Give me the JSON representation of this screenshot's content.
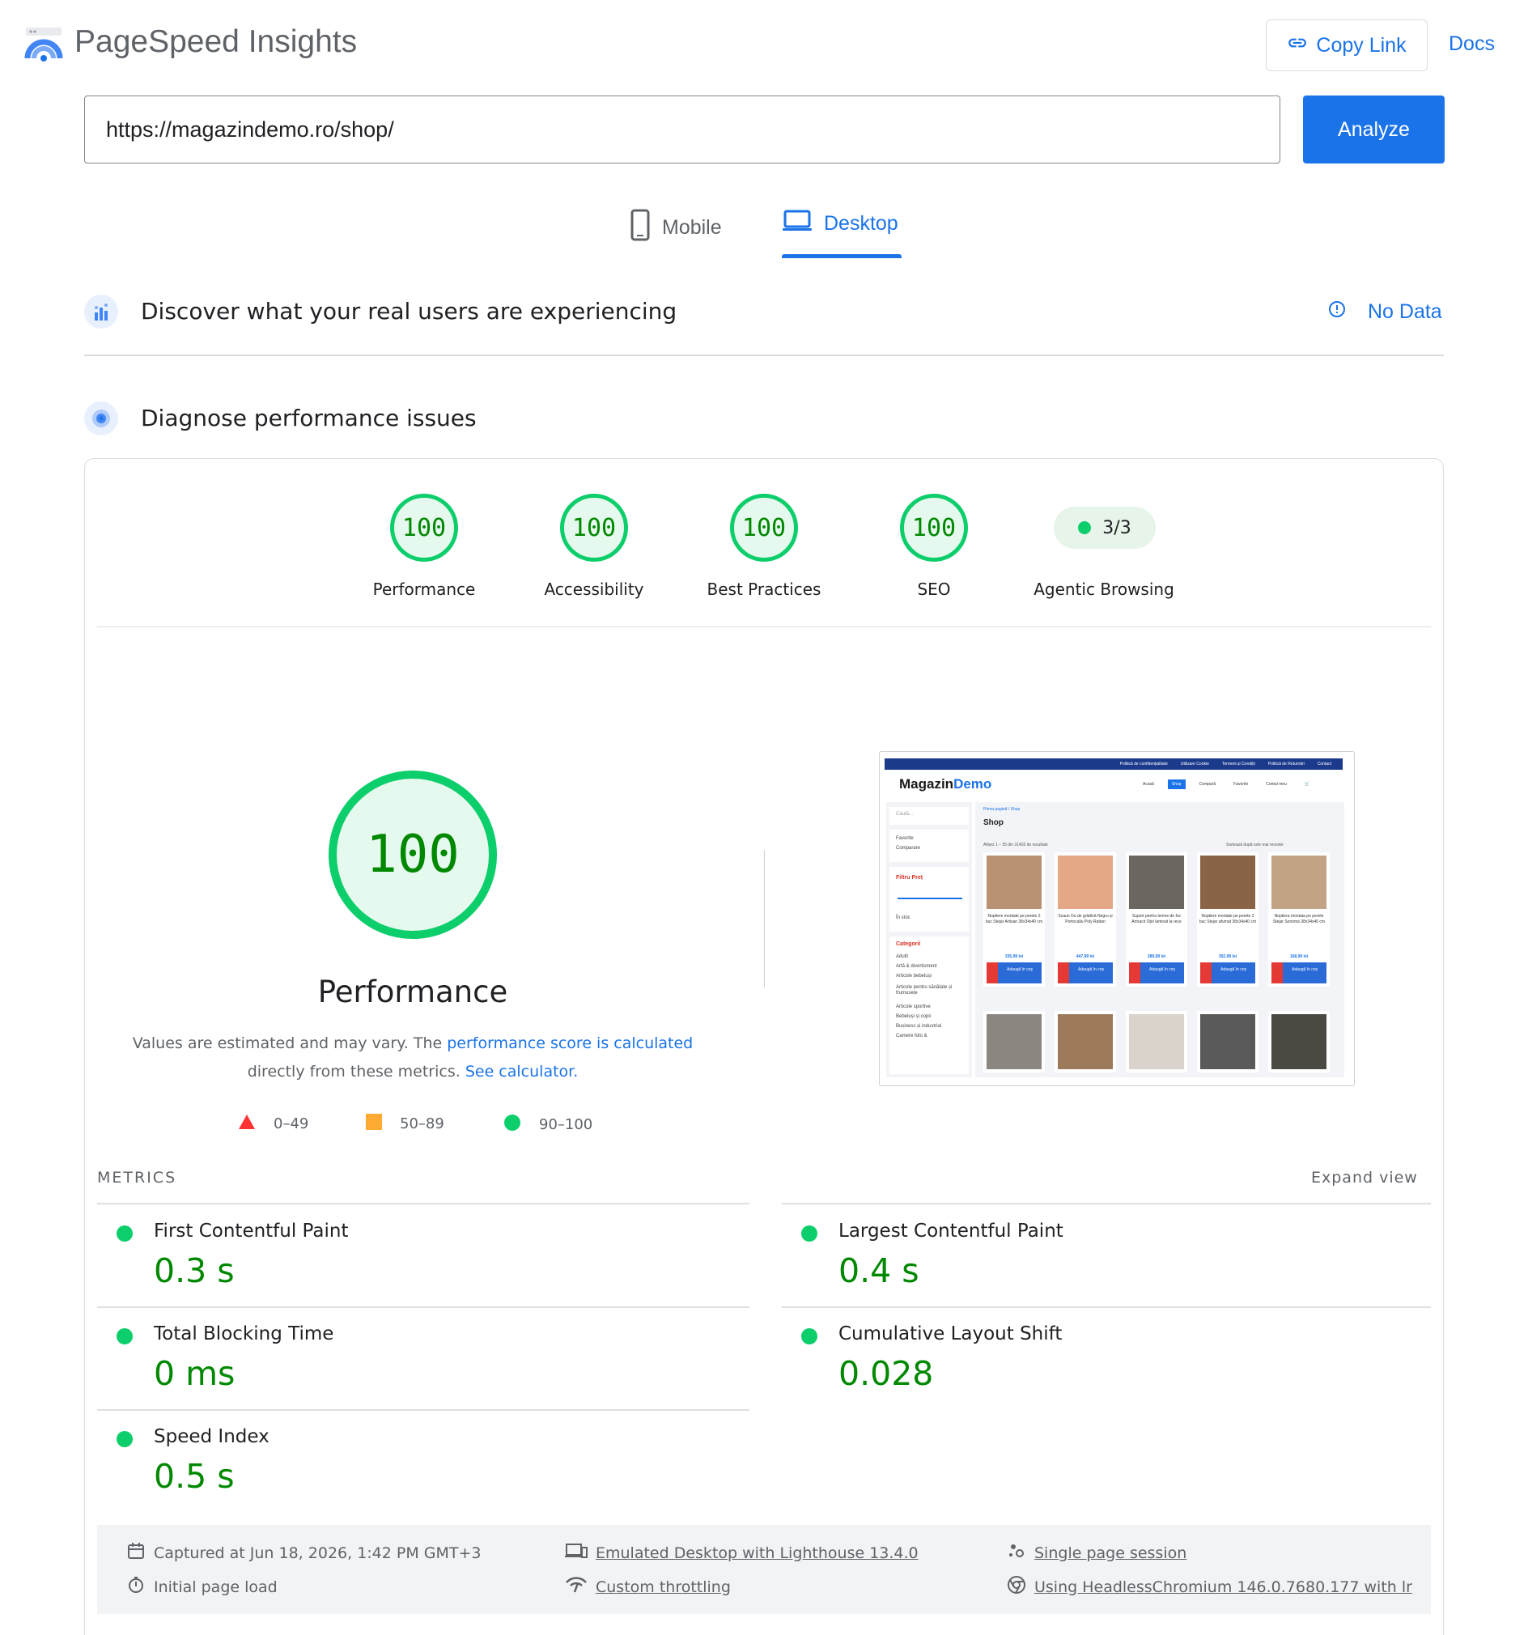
{
  "header": {
    "app_title": "PageSpeed Insights",
    "copy_link_label": "Copy Link",
    "docs_label": "Docs"
  },
  "search": {
    "url_value": "https://magazindemo.ro/shop/",
    "analyze_label": "Analyze"
  },
  "tabs": [
    {
      "label": "Mobile",
      "icon": "phone-icon",
      "selected": false
    },
    {
      "label": "Desktop",
      "icon": "laptop-icon",
      "selected": true
    }
  ],
  "real_users": {
    "title": "Discover what your real users are experiencing",
    "status": "No Data"
  },
  "diagnose": {
    "title": "Diagnose performance issues"
  },
  "categories": [
    {
      "score": "100",
      "label": "Performance"
    },
    {
      "score": "100",
      "label": "Accessibility"
    },
    {
      "score": "100",
      "label": "Best Practices"
    },
    {
      "score": "100",
      "label": "SEO"
    },
    {
      "score": "3/3",
      "label": "Agentic Browsing"
    }
  ],
  "performance": {
    "score": "100",
    "title": "Performance",
    "desc_prefix": "Values are estimated and may vary. The ",
    "desc_link1": "performance score is calculated",
    "desc_middle": " directly from these metrics. ",
    "desc_link2": "See calculator.",
    "legend": [
      {
        "range": "0–49",
        "shape": "triangle",
        "color": "#ff3333"
      },
      {
        "range": "50–89",
        "shape": "square",
        "color": "#ffaa33"
      },
      {
        "range": "90–100",
        "shape": "circle",
        "color": "#0cce6b"
      }
    ]
  },
  "screenshot": {
    "topbar_links": [
      "Politică de confidențialitate",
      "Utilizare Cookie",
      "Termeni și Condiții",
      "Politică de Returnări",
      "Contact"
    ],
    "brand_a": "Magazin",
    "brand_b": "Demo",
    "nav": [
      "Acasă",
      "Shop",
      "Compară",
      "Favorite",
      "Contul meu"
    ],
    "search_placeholder": "Caută...",
    "side_links": [
      "Favorite",
      "Comparare"
    ],
    "filter_title": "Filtru Preț",
    "in_stock": "În stoc",
    "categories_title": "Categorii",
    "category_list": [
      "Adulti",
      "Artă & divertisment",
      "Articole bebeluși",
      "Articole pentru sănătate și frumusețe",
      "Articole sportive",
      "Bebeluși și copii",
      "Business și industrial",
      "Camere foto &"
    ],
    "breadcrumb": "Prima pagină / Shop",
    "page_title": "Shop",
    "results": "Afișez 1 – 25 din 31402 de rezultate",
    "sort": "Sortează după cele mai recente",
    "products": [
      {
        "name": "Noptiere montate pe perete 2 buc Stejar Artisan 38x34x40 cm",
        "price": "335,99 lei"
      },
      {
        "name": "Scaun Ou de grădină Negru și Portocaliu Poly Rattan",
        "price": "447,99 lei"
      },
      {
        "name": "Suport pentru lemne de foc Antracit Oțel laminat la rece",
        "price": "289,99 lei"
      },
      {
        "name": "Noptiere montate pe perete 2 buc Stejar afumat 38x34x40 cm",
        "price": "302,99 lei"
      },
      {
        "name": "Noptiera montata pe perete Stejar Sonoma 38x34x40 cm",
        "price": "168,99 lei"
      }
    ],
    "add_to_cart": "Adaugă în coș"
  },
  "metrics": {
    "label": "METRICS",
    "expand_label": "Expand view",
    "items": [
      {
        "name": "First Contentful Paint",
        "value": "0.3 s"
      },
      {
        "name": "Largest Contentful Paint",
        "value": "0.4 s"
      },
      {
        "name": "Total Blocking Time",
        "value": "0 ms"
      },
      {
        "name": "Cumulative Layout Shift",
        "value": "0.028"
      },
      {
        "name": "Speed Index",
        "value": "0.5 s"
      }
    ]
  },
  "run_info": {
    "captured": "Captured at Jun 18, 2026, 1:42 PM GMT+3",
    "load": "Initial page load",
    "emulated": "Emulated Desktop with Lighthouse 13.4.0",
    "throttling": "Custom throttling",
    "session": "Single page session",
    "browser": "Using HeadlessChromium 146.0.7680.177 with lr"
  },
  "colors": {
    "accent": "#1a73e8",
    "pass_green": "#0cce6b",
    "pass_text": "#008800"
  }
}
